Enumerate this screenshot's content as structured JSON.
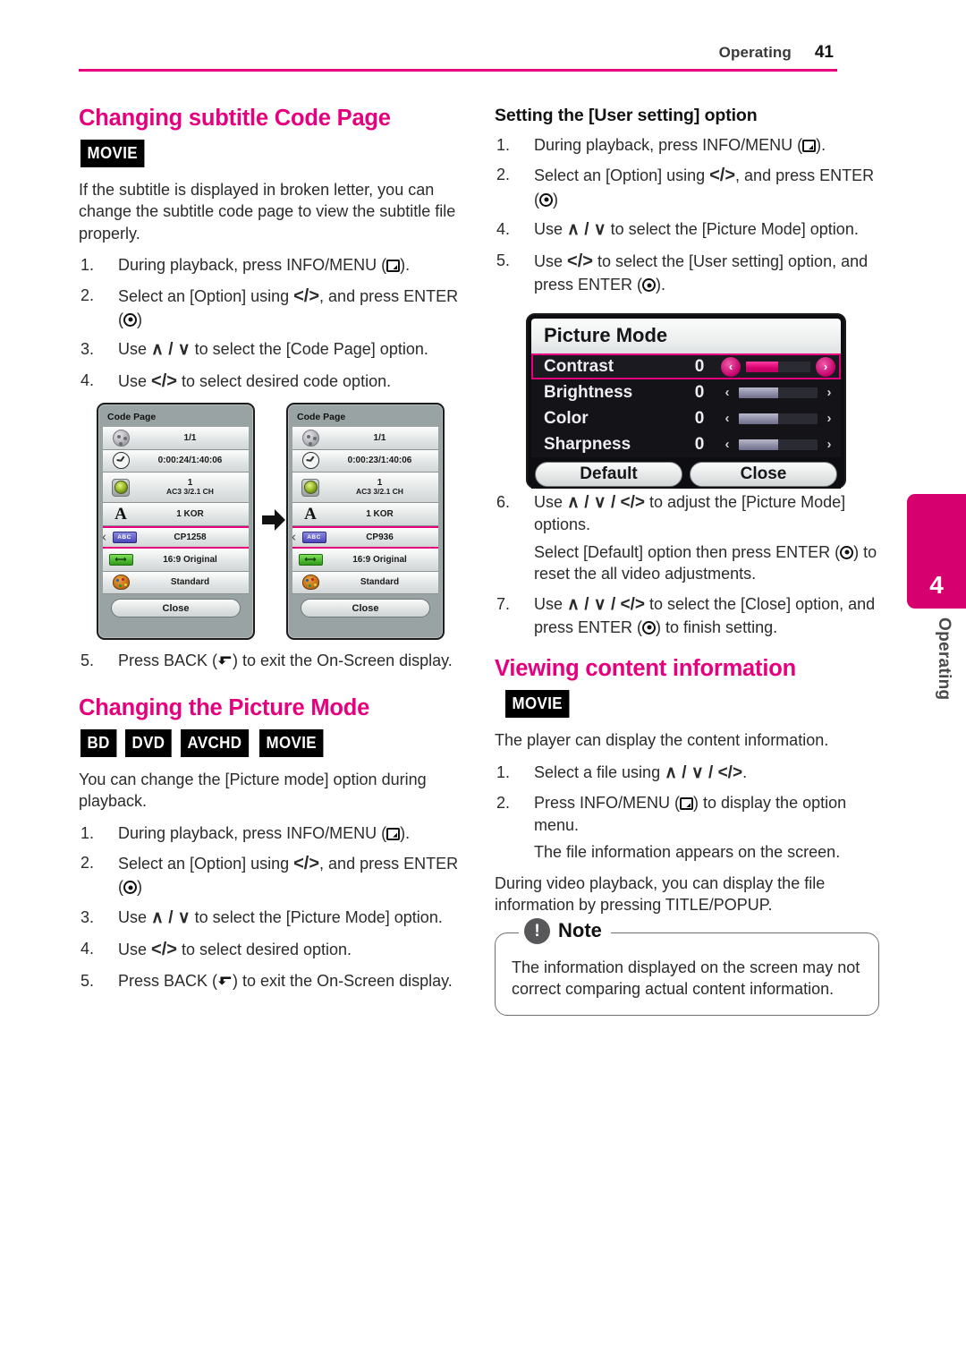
{
  "header": {
    "section": "Operating",
    "page_number": "41"
  },
  "left": {
    "title": "Changing subtitle Code Page",
    "badges": [
      "MOVIE"
    ],
    "intro": "If the subtitle is displayed in broken letter, you can change the subtitle code page to view the subtitle file properly.",
    "steps": [
      {
        "num": "1.",
        "text_before": "During playback, press INFO/MENU (",
        "icon": "menu-icon",
        "text_after": ")."
      },
      {
        "num": "2.",
        "text_before": "Select an [Option] using ",
        "keys": "</>",
        "text_after": ", and press ENTER (",
        "icon": "enter-icon",
        "text_end": ")"
      },
      {
        "num": "3.",
        "text_before": "Use ",
        "keys": "∧ / ∨",
        "text_after": " to select the [Code Page] option."
      },
      {
        "num": "4.",
        "text_before": "Use ",
        "keys": "</>",
        "text_after": " to select desired code option."
      }
    ],
    "step5": {
      "num": "5.",
      "text_before": "Press BACK (",
      "icon": "back-icon",
      "text_after": ") to exit the On-Screen display."
    },
    "title2": "Changing the Picture Mode",
    "badges2": [
      "BD",
      "DVD",
      "AVCHD",
      "MOVIE"
    ],
    "intro2": "You can change the [Picture mode] option during playback.",
    "steps2": [
      {
        "num": "1.",
        "text_before": "During playback, press INFO/MENU (",
        "icon": "menu-icon",
        "text_after": ")."
      },
      {
        "num": "2.",
        "text_before": "Select an [Option] using ",
        "keys": "</>",
        "text_after": ", and press ENTER (",
        "icon": "enter-icon",
        "text_end": ")"
      },
      {
        "num": "3.",
        "text_before": "Use ",
        "keys": "∧ / ∨",
        "text_after": " to select the [Picture Mode] option."
      },
      {
        "num": "4.",
        "text_before": "Use ",
        "keys": "</>",
        "text_after": " to select desired option."
      },
      {
        "num": "5.",
        "text_before": "Press BACK (",
        "icon": "back-icon",
        "text_after": ") to exit the On-Screen display."
      }
    ]
  },
  "codepage_figure": {
    "before": {
      "title": "Code Page",
      "rows": [
        {
          "icon": "film-reel-icon",
          "value": "1/1"
        },
        {
          "icon": "clock-icon",
          "value": "0:00:24/1:40:06"
        },
        {
          "icon": "disc-icon",
          "value": "1",
          "sub": "AC3    3/2.1 CH"
        },
        {
          "icon": "subtitle-A-icon",
          "value": "1 KOR"
        },
        {
          "icon": "codepage-abc-icon",
          "value": "CP1258",
          "selected": true
        },
        {
          "icon": "aspect-ratio-icon",
          "value": "16:9 Original"
        },
        {
          "icon": "palette-icon",
          "value": "Standard"
        }
      ],
      "close_label": "Close"
    },
    "after": {
      "title": "Code Page",
      "rows": [
        {
          "icon": "film-reel-icon",
          "value": "1/1"
        },
        {
          "icon": "clock-icon",
          "value": "0:00:23/1:40:06"
        },
        {
          "icon": "disc-icon",
          "value": "1",
          "sub": "AC3    3/2.1 CH"
        },
        {
          "icon": "subtitle-A-icon",
          "value": "1 KOR"
        },
        {
          "icon": "codepage-abc-icon",
          "value": "CP936",
          "selected": true
        },
        {
          "icon": "aspect-ratio-icon",
          "value": "16:9 Original"
        },
        {
          "icon": "palette-icon",
          "value": "Standard"
        }
      ],
      "close_label": "Close"
    },
    "abc_badge_text": "ABC"
  },
  "right": {
    "subtitle1": "Setting the [User setting] option",
    "steps": [
      {
        "num": "1.",
        "text_before": "During playback, press INFO/MENU (",
        "icon": "menu-icon",
        "text_after": ")."
      },
      {
        "num": "2.",
        "text_before": "Select an [Option] using ",
        "keys": "</>",
        "text_after": ", and press ENTER (",
        "icon": "enter-icon",
        "text_end": ")"
      },
      {
        "num": "4.",
        "text_before": "Use ",
        "keys": "∧ / ∨",
        "text_after": " to select the [Picture Mode] option."
      },
      {
        "num": "5.",
        "text_before": "Use ",
        "keys": "</>",
        "text_after": " to select the [User setting] option, and press ENTER (",
        "icon": "enter-icon",
        "text_end": ")."
      }
    ],
    "steps_after": [
      {
        "num": "6.",
        "text_before": "Use ",
        "keys": "∧ / ∨ / </>",
        "text_after": " to adjust the [Picture Mode] options."
      },
      {
        "num": "",
        "cont": true,
        "text_before": "Select [Default] option then press ENTER (",
        "icon": "enter-icon",
        "text_after": ") to reset the all video adjustments."
      },
      {
        "num": "7.",
        "text_before": "Use ",
        "keys": "∧ / ∨ / </>",
        "text_after": " to select the [Close] option, and press ENTER (",
        "icon": "enter-icon",
        "text_end": ") to finish setting."
      }
    ],
    "title2": "Viewing content information",
    "badges2": [
      "MOVIE"
    ],
    "intro2": "The player can display the content information.",
    "steps3": [
      {
        "num": "1.",
        "text_before": "Select a file using ",
        "keys": "∧ / ∨ / </>",
        "text_after": "."
      },
      {
        "num": "2.",
        "text_before": "Press INFO/MENU (",
        "icon": "menu-icon",
        "text_after": ") to display the option menu."
      },
      {
        "num": "",
        "cont": true,
        "text_before": "The file information appears on the screen."
      }
    ],
    "closing": "During video playback, you can display the file information by pressing TITLE/POPUP.",
    "note": {
      "label": "Note",
      "bang": "!",
      "body": "The information displayed on the screen may not correct comparing actual content information."
    }
  },
  "picture_mode_figure": {
    "title": "Picture Mode",
    "rows": [
      {
        "label": "Contrast",
        "value": "0",
        "fill_pct": 50,
        "selected": true
      },
      {
        "label": "Brightness",
        "value": "0",
        "fill_pct": 50,
        "selected": false
      },
      {
        "label": "Color",
        "value": "0",
        "fill_pct": 50,
        "selected": false
      },
      {
        "label": "Sharpness",
        "value": "0",
        "fill_pct": 50,
        "selected": false
      }
    ],
    "buttons": [
      "Default",
      "Close"
    ],
    "left_arrow": "‹",
    "right_arrow": "›"
  },
  "side_tab": {
    "number": "4",
    "label": "Operating"
  },
  "colors": {
    "accent_pink": "#e6007e",
    "tab_magenta": "#d6006e",
    "text": "#2b2b2b"
  }
}
